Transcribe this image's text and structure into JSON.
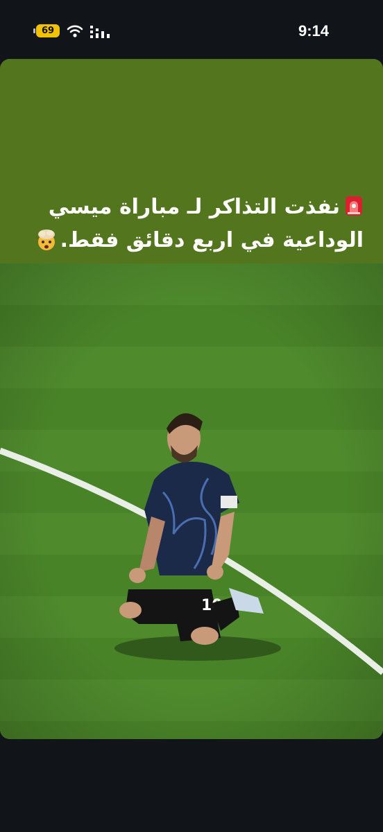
{
  "status_bar": {
    "battery_level": "69",
    "time": "9:14",
    "icons": [
      "battery-icon",
      "wifi-icon",
      "cellular-signal-icon"
    ]
  },
  "story": {
    "caption_line1": "نفذت التذاكر لـ مباراة ميسي",
    "caption_line2": "الوداعية في اربع دقائق فقط.",
    "emoji_start": "rotating-light-emoji",
    "emoji_end": "exploding-head-emoji",
    "caption_background": "#52751e",
    "photo_subject": "football-player-kneeling-on-pitch",
    "jersey_number": "10"
  }
}
